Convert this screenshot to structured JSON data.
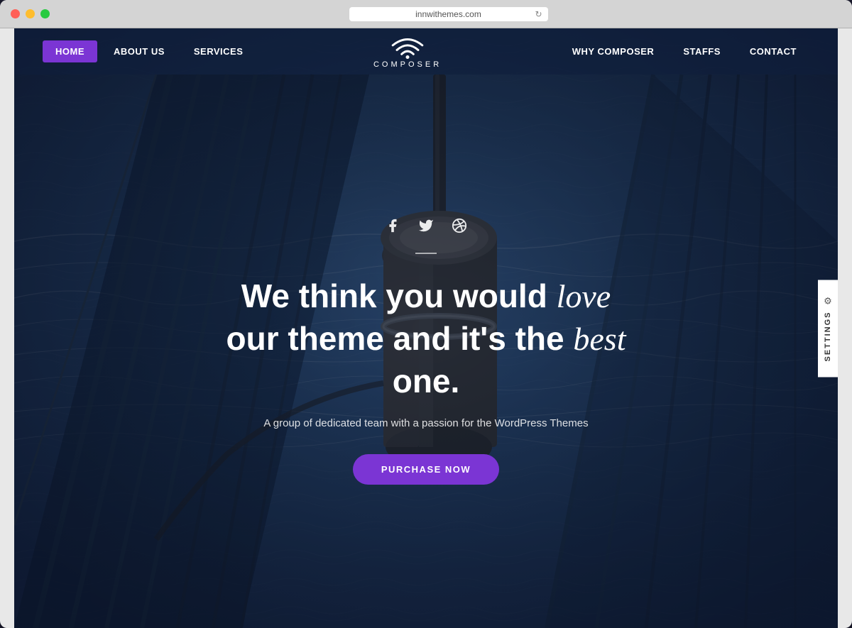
{
  "window": {
    "url": "innwithemes.com",
    "buttons": {
      "close": "close",
      "minimize": "minimize",
      "maximize": "maximize"
    }
  },
  "navbar": {
    "logo_text": "COMPOSER",
    "nav_left": [
      {
        "id": "home",
        "label": "HOME",
        "active": true
      },
      {
        "id": "about",
        "label": "ABOUT US",
        "active": false
      },
      {
        "id": "services",
        "label": "SERVICES",
        "active": false
      }
    ],
    "nav_right": [
      {
        "id": "why",
        "label": "WHY COMPOSER",
        "active": false
      },
      {
        "id": "staffs",
        "label": "STAFFS",
        "active": false
      },
      {
        "id": "contact",
        "label": "CONTACT",
        "active": false
      }
    ]
  },
  "hero": {
    "social_icons": [
      "facebook",
      "twitter",
      "dribbble"
    ],
    "headline_part1": "We think you would ",
    "headline_italic1": "love",
    "headline_part2": " our theme and it's the ",
    "headline_italic2": "best",
    "headline_part3": " one.",
    "subtitle": "A group of dedicated team with a passion for the WordPress Themes",
    "cta_button": "PURCHASE NOW"
  },
  "settings_tab": {
    "label": "SETTINGS"
  },
  "colors": {
    "accent": "#7b35d4",
    "nav_bg": "rgba(15,30,60,0.6)",
    "hero_overlay": "rgba(20,45,90,0.65)"
  }
}
